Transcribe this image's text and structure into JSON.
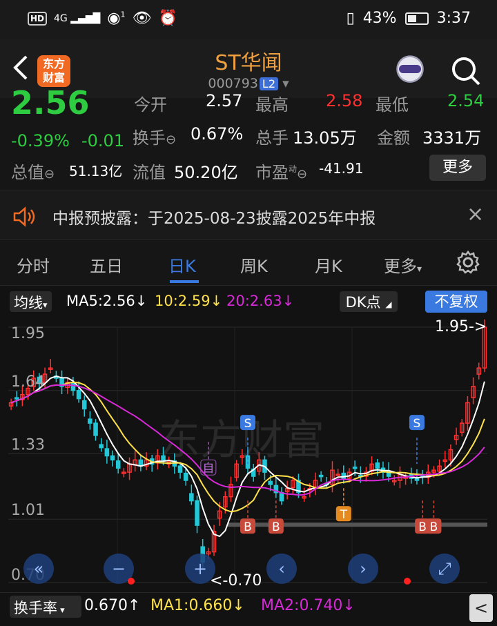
{
  "status_bar": {
    "net_tag": "HD",
    "signal": "4G",
    "alarm_count": "1",
    "battery": "43%",
    "time": "3:37"
  },
  "header": {
    "back_label": "<",
    "logo_text_1": "东方",
    "logo_text_2": "财富",
    "title": "ST华闻",
    "code": "000793",
    "level": "L2"
  },
  "quote": {
    "price": "2.56",
    "change_pct": "-0.39%",
    "change": "-0.01",
    "hidden_row": {
      "open_label": "今开",
      "open": "2.57",
      "high_label": "最高",
      "high": "2.58",
      "low_label": "最低",
      "low": "2.54"
    },
    "turnover_label": "换手",
    "turnover": "0.67%",
    "total_hands_label": "总手",
    "total_hands": "13.05万",
    "amount_label": "金额",
    "amount": "3331万",
    "market_cap_label": "总值",
    "market_cap": "51.13亿",
    "float_cap_label": "流值",
    "float_cap": "50.20亿",
    "pe_label": "市盈",
    "pe_sup": "动",
    "pe": "-41.91",
    "more": "更多"
  },
  "notice": {
    "text": "中报预披露：于2025-08-23披露2025年中报",
    "close": "×"
  },
  "tabs": [
    "分时",
    "五日",
    "日K",
    "周K",
    "月K",
    "更多",
    "设置"
  ],
  "active_tab": "日K",
  "ma_bar": {
    "selector": "均线",
    "ma5": "MA5:2.56",
    "ma10": "10:2.59",
    "ma20": "20:2.63",
    "dk": "DK点",
    "adjust": "不复权"
  },
  "chart_data": {
    "type": "candlestick",
    "y_ticks": [
      "1.95",
      "1.64",
      "1.33",
      "1.01",
      "0.70"
    ],
    "ylim": [
      0.7,
      1.95
    ],
    "max_label": "1.95->",
    "min_label": "<-0.70",
    "markers": [
      {
        "label": "S",
        "date_index": 42
      },
      {
        "label": "S",
        "date_index": 72
      },
      {
        "label": "B",
        "date_index": 42
      },
      {
        "label": "B",
        "date_index": 47
      },
      {
        "label": "T",
        "date_index": 59
      },
      {
        "label": "B",
        "date_index": 73
      },
      {
        "label": "B",
        "date_index": 75
      },
      {
        "label": "自",
        "date_index": 35
      }
    ],
    "watermark": "东方财富",
    "closes": [
      1.58,
      1.6,
      1.62,
      1.65,
      1.7,
      1.68,
      1.72,
      1.75,
      1.7,
      1.66,
      1.68,
      1.64,
      1.6,
      1.55,
      1.48,
      1.42,
      1.36,
      1.32,
      1.3,
      1.26,
      1.24,
      1.28,
      1.3,
      1.27,
      1.3,
      1.28,
      1.32,
      1.3,
      1.29,
      1.27,
      1.24,
      1.2,
      1.1,
      0.98,
      0.8,
      0.85,
      0.95,
      1.05,
      1.12,
      1.18,
      1.28,
      1.32,
      1.26,
      1.22,
      1.3,
      1.24,
      1.18,
      1.14,
      1.1,
      1.16,
      1.2,
      1.14,
      1.12,
      1.16,
      1.2,
      1.22,
      1.18,
      1.25,
      1.23,
      1.21,
      1.24,
      1.26,
      1.22,
      1.24,
      1.28,
      1.26,
      1.24,
      1.22,
      1.2,
      1.23,
      1.22,
      1.21,
      1.2,
      1.22,
      1.24,
      1.25,
      1.27,
      1.3,
      1.35,
      1.42,
      1.48,
      1.58,
      1.66,
      1.75,
      1.95
    ]
  },
  "bottom": {
    "selector": "换手率",
    "val": "0.670",
    "ma1": "MA1:0.660",
    "ma2": "MA2:0.740",
    "arrow_up": "↑",
    "arrow_down": "↓",
    "collapse": "<"
  },
  "colors": {
    "up": "#ff3030",
    "down": "#22c8d8",
    "ma5": "#ffffff",
    "ma10": "#ffe14a",
    "ma20": "#d829d8",
    "accent": "#3a7ae0"
  }
}
